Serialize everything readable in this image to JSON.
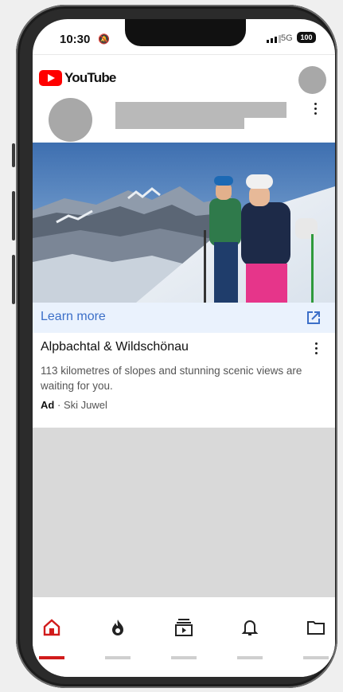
{
  "status_bar": {
    "time": "10:30",
    "network": "5G",
    "battery": "100"
  },
  "app": {
    "logo_text": "YouTube"
  },
  "ad": {
    "cta": "Learn more",
    "title": "Alpbachtal & Wildschönau",
    "description": "113 kilometres of slopes and stunning scenic views are waiting for you.",
    "badge": "Ad",
    "separator": "·",
    "advertiser": "Ski Juwel"
  },
  "bottom_nav": {
    "items": [
      {
        "icon": "home-icon",
        "active": true
      },
      {
        "icon": "explore-flame-icon",
        "active": false
      },
      {
        "icon": "subscriptions-icon",
        "active": false
      },
      {
        "icon": "notifications-bell-icon",
        "active": false
      },
      {
        "icon": "library-folder-icon",
        "active": false
      }
    ]
  },
  "colors": {
    "brand_red": "#ff0000",
    "link_blue": "#3c6fc8",
    "active_tab": "#d11b1b"
  }
}
